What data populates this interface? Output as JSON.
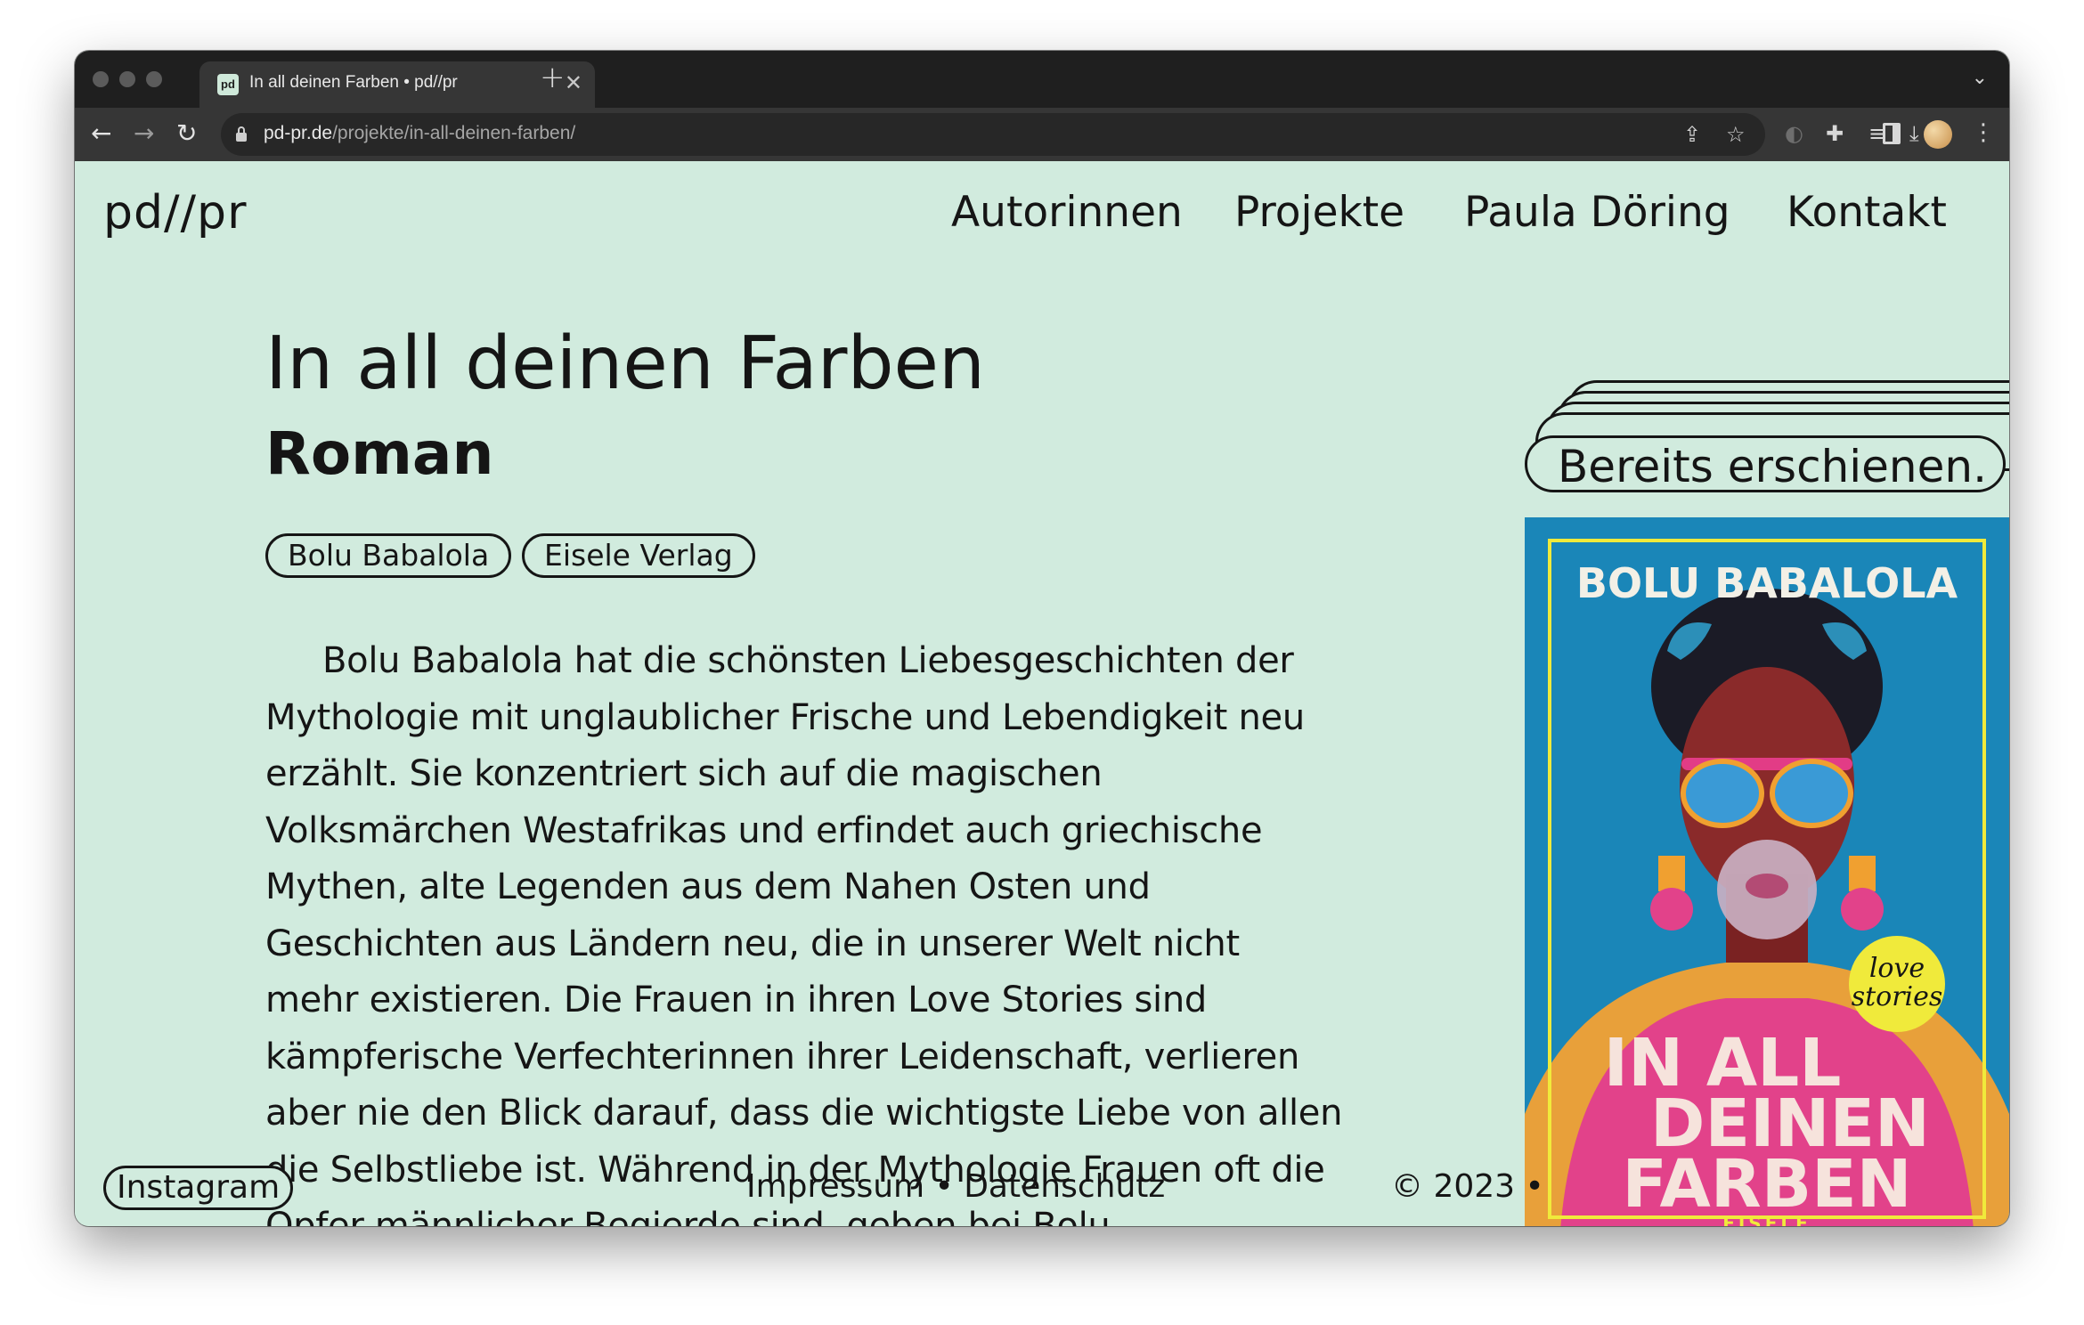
{
  "browser": {
    "tab_title": "In all deinen Farben • pd//pr",
    "tab_favicon": "pd",
    "url_host": "pd-pr.de",
    "url_path": "/projekte/in-all-deinen-farben/",
    "icons": [
      "back-icon",
      "forward-icon",
      "reload-icon",
      "lock-icon",
      "share-icon",
      "star-icon",
      "extension-icon",
      "puzzle-icon",
      "media-icon",
      "download-icon",
      "sidepanel-icon",
      "profile-avatar",
      "menu-icon"
    ]
  },
  "site": {
    "logo": "pd//pr",
    "nav": [
      "Autorinnen",
      "Projekte",
      "Paula Döring",
      "Kontakt"
    ]
  },
  "project": {
    "title": "In all deinen Farben",
    "subtitle": "Roman",
    "tags": [
      "Bolu Babalola",
      "Eisele Verlag"
    ],
    "description": "Bolu Babalola hat die schönsten Liebesgeschichten der Mythologie mit unglaublicher Frische und Lebendigkeit neu erzählt. Sie konzentriert sich auf die magischen Volksmärchen Westafrikas und erfindet auch griechische Mythen, alte Legenden aus dem Nahen Osten und Geschichten aus Ländern neu, die in unserer Welt nicht mehr existieren. Die Frauen in ihren Love Stories sind kämpferische Verfechterinnen ihrer Leidenschaft, verlieren aber nie den Blick darauf, dass die wichtigste Liebe von allen die Selbstliebe ist. Während in der Mythologie Frauen oft die Opfer männlicher Begierde sind, geben bei Bolu",
    "status_badge": "Bereits erschienen.",
    "cover": {
      "author": "BOLU BABALOLA",
      "title_lines": [
        "IN ALL",
        "DEINEN",
        "FARBEN"
      ],
      "sticker_lines": [
        "love",
        "stories"
      ],
      "publisher": "EISELE"
    }
  },
  "footer": {
    "instagram": "Instagram",
    "links": "Impressum • Datenschutz",
    "copyright": "© 2023 •"
  },
  "colors": {
    "page_background": "#d1ebde",
    "text": "#151515",
    "cover_blue": "#1a86b8",
    "cover_pink": "#e2428a",
    "cover_yellow": "#f0ea3b"
  }
}
